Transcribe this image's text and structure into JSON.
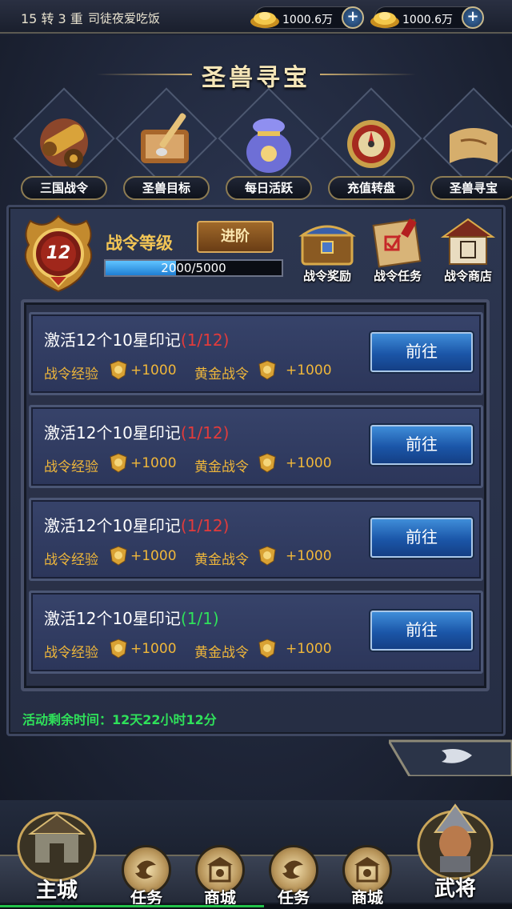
{
  "topbar": {
    "level": "15 转 3 重",
    "player_name": "司徒夜爱吃饭",
    "currency": [
      {
        "amount": "1000.6万",
        "icon": "gold-ingot-icon"
      },
      {
        "amount": "1000.6万",
        "icon": "silver-ingot-icon"
      }
    ],
    "plus": "+"
  },
  "page": {
    "title": "圣兽寻宝"
  },
  "activities": [
    {
      "label": "三国战令",
      "icon": "cannon-icon"
    },
    {
      "label": "圣兽目标",
      "icon": "scroll-brush-icon"
    },
    {
      "label": "每日活跃",
      "icon": "treasure-bag-icon"
    },
    {
      "label": "充值转盘",
      "icon": "dragon-wheel-icon"
    },
    {
      "label": "圣兽寻宝",
      "icon": "map-scroll-icon"
    }
  ],
  "battlepass": {
    "level": "12",
    "level_title": "战令等级",
    "advance_label": "进阶",
    "xp_text": "2000/5000",
    "xp_fraction": 0.4,
    "sub_buttons": [
      {
        "label": "战令奖励",
        "icon": "treasure-chest-icon"
      },
      {
        "label": "战令任务",
        "icon": "task-scroll-icon"
      },
      {
        "label": "战令商店",
        "icon": "shop-icon"
      }
    ]
  },
  "tasks": [
    {
      "title": "激活12个10星印记",
      "progress": "(1/12)",
      "progress_color": "#e23b3b",
      "reward1_label": "战令经验",
      "reward1_value": "+1000",
      "reward2_label": "黄金战令",
      "reward2_value": "+1000",
      "button": "前往"
    },
    {
      "title": "激活12个10星印记",
      "progress": "(1/12)",
      "progress_color": "#e23b3b",
      "reward1_label": "战令经验",
      "reward1_value": "+1000",
      "reward2_label": "黄金战令",
      "reward2_value": "+1000",
      "button": "前往"
    },
    {
      "title": "激活12个10星印记",
      "progress": "(1/12)",
      "progress_color": "#e23b3b",
      "reward1_label": "战令经验",
      "reward1_value": "+1000",
      "reward2_label": "黄金战令",
      "reward2_value": "+1000",
      "button": "前往"
    },
    {
      "title": "激活12个10星印记",
      "progress": "(1/1)",
      "progress_color": "#2fe15a",
      "reward1_label": "战令经验",
      "reward1_value": "+1000",
      "reward2_label": "黄金战令",
      "reward2_value": "+1000",
      "button": "前往"
    }
  ],
  "timer": "活动剩余时间：12天22小时12分",
  "bottom_nav": {
    "main_city": "主城",
    "items": [
      {
        "label": "任务",
        "icon": "swirl-icon"
      },
      {
        "label": "商城",
        "icon": "coin-shop-icon"
      },
      {
        "label": "任务",
        "icon": "swirl-icon"
      },
      {
        "label": "商城",
        "icon": "coin-shop-icon"
      }
    ],
    "generals": "武将"
  },
  "colors": {
    "gold_text": "#f0b73a",
    "progress_red": "#e23b3b",
    "progress_green": "#2fe15a",
    "button_blue": "#1b56a8"
  }
}
